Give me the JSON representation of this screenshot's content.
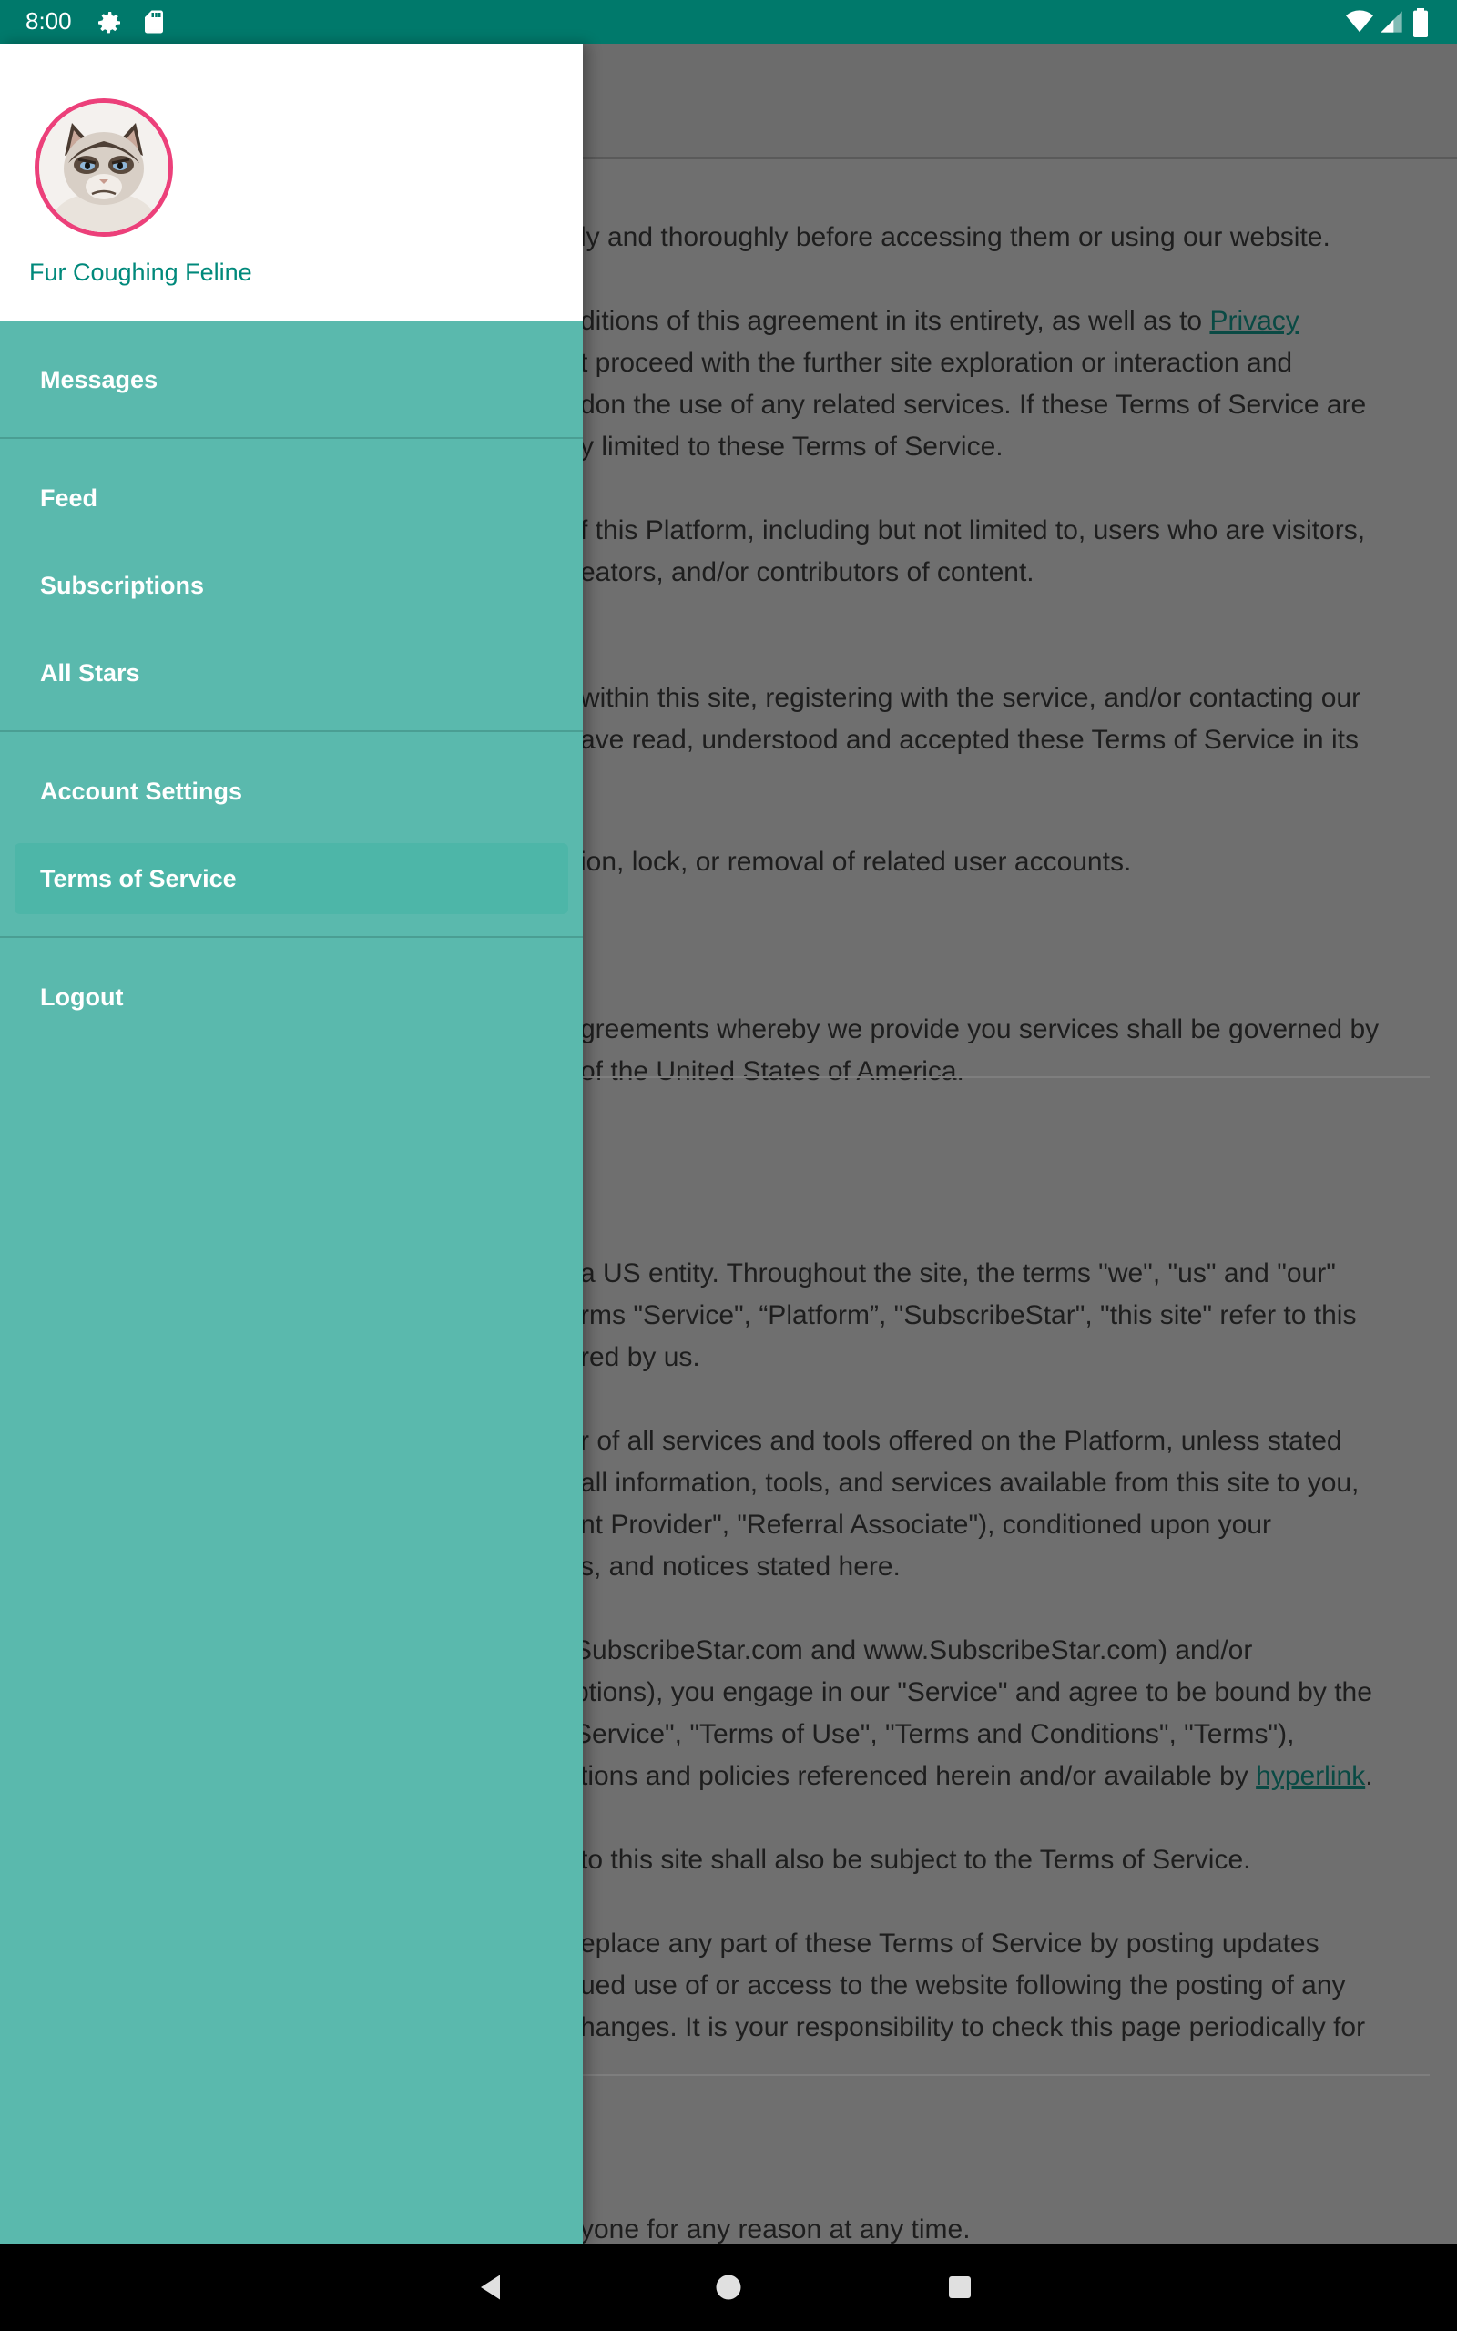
{
  "status_bar": {
    "time": "8:00",
    "icons": [
      "gear-icon",
      "sd-card-icon",
      "wifi-icon",
      "signal-icon",
      "battery-icon"
    ]
  },
  "background_page": {
    "paragraphs": [
      {
        "lines": [
          "ly and thoroughly before accessing them or using our website."
        ]
      },
      {
        "lines": [
          "ditions of this agreement in its entirety, as well as to ",
          "t proceed with the further site exploration or interaction and",
          "don the use of any related services. If these Terms of Service are",
          "y limited to these Terms of Service."
        ],
        "link": "Privacy"
      },
      {
        "lines": [
          "f this Platform, including but not limited to, users who are visitors,",
          "eators, and/or contributors of content."
        ]
      },
      {
        "lines": [
          "within this site, registering with the service, and/or contacting our",
          "ave read, understood and accepted these Terms of Service in its"
        ]
      },
      {
        "lines": [
          "ion, lock, or removal of related user accounts."
        ]
      },
      {
        "lines": [
          "greements whereby we provide you services shall be governed by",
          " of the United States of America."
        ]
      },
      {
        "lines": [
          "a US entity. Throughout the site, the terms \"we\", \"us\" and \"our\"",
          "rms \"Service\", “Platform”, \"SubscribeStar\", \"this site\" refer to this",
          "red by us."
        ]
      },
      {
        "lines": [
          "r of all services and tools offered on the Platform, unless stated",
          "all information, tools, and services available from this site to you,",
          "nt Provider\", \"Referral Associate\"), conditioned upon your",
          "s, and notices stated here."
        ]
      },
      {
        "lines": [
          "SubscribeStar.com and www.SubscribeStar.com) and/or",
          "ptions), you engage in our \"Service\" and agree to be bound by the",
          "Service\", \"Terms of Use\", \"Terms and Conditions\", \"Terms\"),",
          "tions and policies referenced herein and/or available by "
        ],
        "link2": "hyperlink"
      },
      {
        "lines": [
          "to this site shall also be subject to the Terms of Service."
        ]
      },
      {
        "lines": [
          "eplace any part of these Terms of Service by posting updates",
          "ued use of or access to the website following the posting of any",
          "hanges. It is your responsibility to check this page periodically for"
        ]
      },
      {
        "lines": [
          "yone for any reason at any time."
        ]
      }
    ]
  },
  "drawer": {
    "user_name": "Fur Coughing Feline",
    "avatar": "grumpy-cat-avatar",
    "items": [
      {
        "label": "Messages"
      },
      {
        "label": "Feed"
      },
      {
        "label": "Subscriptions"
      },
      {
        "label": "All Stars"
      },
      {
        "label": "Account Settings"
      },
      {
        "label": "Terms of Service",
        "active": true
      },
      {
        "label": "Logout"
      }
    ]
  },
  "colors": {
    "status_bar": "#00796b",
    "drawer": "#5ab9ad",
    "active_item": "#4db6a8",
    "user_name": "#00897b",
    "avatar_ring": "#ec407a"
  },
  "nav_bar": {
    "icons": [
      "back-icon",
      "home-icon",
      "recents-icon"
    ]
  }
}
